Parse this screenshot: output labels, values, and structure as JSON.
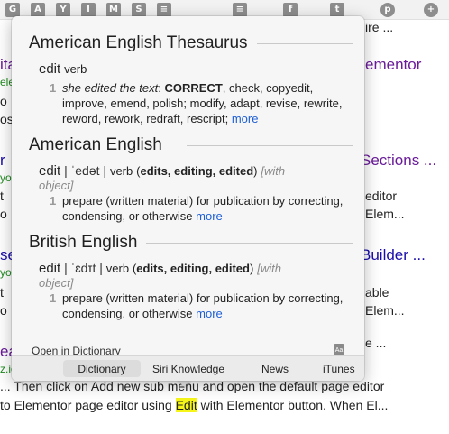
{
  "toolbar": {
    "icons": [
      {
        "name": "g-icon",
        "glyph": "G"
      },
      {
        "name": "a-icon",
        "glyph": "A"
      },
      {
        "name": "y-icon",
        "glyph": "Y"
      },
      {
        "name": "i-icon",
        "glyph": "I"
      },
      {
        "name": "m-icon",
        "glyph": "M"
      },
      {
        "name": "s-icon",
        "glyph": "S"
      },
      {
        "name": "stack-icon",
        "glyph": "≡"
      },
      {
        "name": "stack2-icon",
        "glyph": "≡"
      },
      {
        "name": "f-icon",
        "glyph": "f"
      },
      {
        "name": "twitter-icon",
        "glyph": "t"
      },
      {
        "name": "pinterest-icon",
        "glyph": "p"
      },
      {
        "name": "share-icon",
        "glyph": "+"
      }
    ]
  },
  "background": {
    "right_text_top": "ire ...",
    "link_elementor": "ementor",
    "link_sections": "Sections ...",
    "text_editor": "editor",
    "text_elem1": "Elem...",
    "link_builder": "Builder ...",
    "text_able": "able",
    "text_elem2": "Elem...",
    "text_line3": "e ...",
    "left_frags": [
      "ita",
      "ele",
      "o",
      "osi",
      "r",
      "yo",
      "t",
      "o",
      "se",
      "yo",
      "t",
      "o",
      "ea",
      "z.io"
    ],
    "bottom_line1": "... Then click on Add new sub menu and open the default page editor",
    "bottom_line2_a": "to Elementor page editor using ",
    "bottom_line2_hl": "Edit",
    "bottom_line2_b": " with Elementor button. When El..."
  },
  "popover": {
    "sections": [
      {
        "title": "American English Thesaurus",
        "headword": "edit",
        "pos": "verb",
        "sense_num": "1",
        "example": "she edited the text",
        "syn_label": "CORRECT",
        "synonyms": "check, copyedit, improve, emend, polish; modify, adapt, revise, rewrite, reword, rework, redraft, rescript;",
        "more": "more"
      },
      {
        "title": "American English",
        "headword": "edit",
        "pron": "| ˈedət |",
        "pos": "verb",
        "forms": "edits, editing, edited",
        "label": "[with object]",
        "sense_num": "1",
        "definition": "prepare (written material) for publication by correcting, condensing, or otherwise",
        "more": "more"
      },
      {
        "title": "British English",
        "headword": "edit",
        "pron": "| ˈɛdɪt |",
        "pos": "verb",
        "forms": "edits, editing, edited",
        "label": "[with object]",
        "sense_num": "1",
        "definition": "prepare (written material) for publication by correcting, condensing, or otherwise",
        "more": "more"
      }
    ],
    "open_in_dictionary": "Open in Dictionary",
    "tabs": [
      "Dictionary",
      "Siri Knowledge",
      "News",
      "iTunes"
    ],
    "active_tab": "Dictionary"
  }
}
